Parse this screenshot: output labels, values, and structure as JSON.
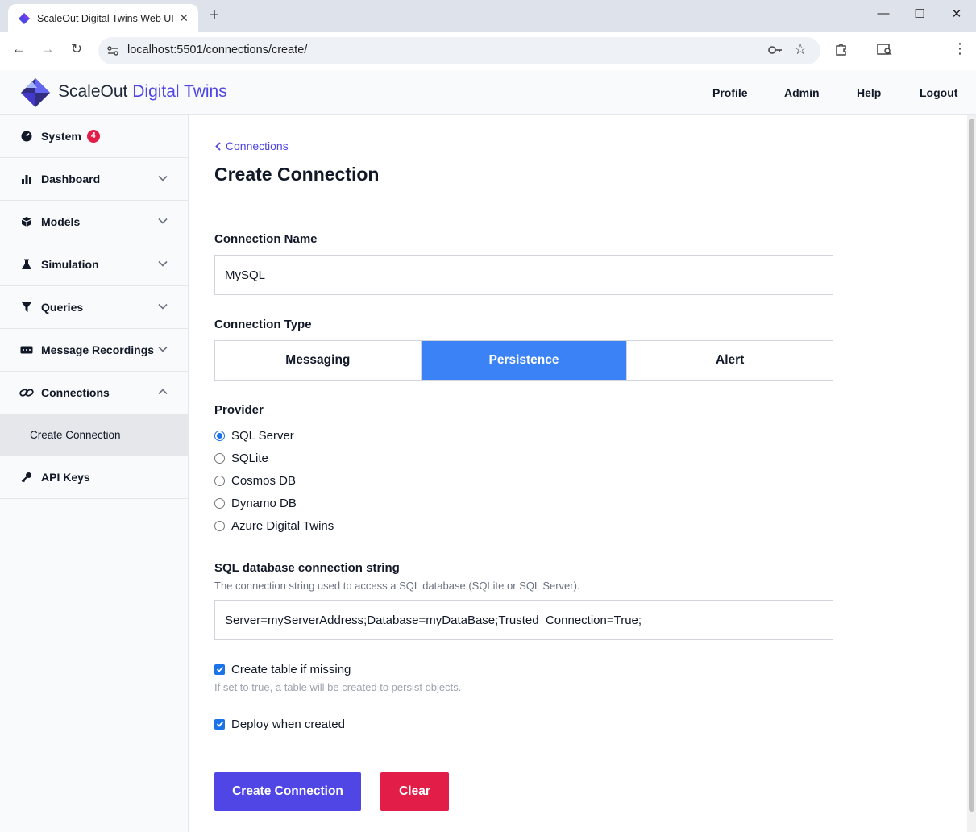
{
  "browser": {
    "tab_title": "ScaleOut Digital Twins Web UI",
    "tab_close": "✕",
    "new_tab": "+",
    "url": "localhost:5501/connections/create/",
    "window_controls": {
      "minimize": "—",
      "maximize": "☐",
      "close": "✕"
    }
  },
  "header": {
    "brand_main": "ScaleOut",
    "brand_accent": "Digital Twins",
    "nav": [
      "Profile",
      "Admin",
      "Help",
      "Logout"
    ]
  },
  "sidebar": {
    "items": [
      {
        "label": "System",
        "badge": "4",
        "icon": "dashboard-gauge-icon"
      },
      {
        "label": "Dashboard",
        "icon": "bar-chart-icon"
      },
      {
        "label": "Models",
        "icon": "cube-icon"
      },
      {
        "label": "Simulation",
        "icon": "flask-icon"
      },
      {
        "label": "Queries",
        "icon": "filter-icon"
      },
      {
        "label": "Message Recordings",
        "icon": "recording-icon"
      },
      {
        "label": "Connections",
        "icon": "link-icon",
        "expanded": true
      },
      {
        "label": "API Keys",
        "icon": "key-icon"
      }
    ],
    "sub_item": "Create Connection"
  },
  "main": {
    "back_link": "Connections",
    "title": "Create Connection",
    "connection_name_label": "Connection Name",
    "connection_name_value": "MySQL",
    "connection_type_label": "Connection Type",
    "connection_types": [
      "Messaging",
      "Persistence",
      "Alert"
    ],
    "selected_type": "Persistence",
    "provider_label": "Provider",
    "providers": [
      "SQL Server",
      "SQLite",
      "Cosmos DB",
      "Dynamo DB",
      "Azure Digital Twins"
    ],
    "selected_provider": "SQL Server",
    "conn_string_label": "SQL database connection string",
    "conn_string_help": "The connection string used to access a SQL database (SQLite or SQL Server).",
    "conn_string_value": "Server=myServerAddress;Database=myDataBase;Trusted_Connection=True;",
    "create_table_label": "Create table if missing",
    "create_table_checked": true,
    "create_table_help": "If set to true, a table will be created to persist objects.",
    "deploy_label": "Deploy when created",
    "deploy_checked": true,
    "create_button": "Create Connection",
    "clear_button": "Clear"
  },
  "colors": {
    "accent": "#4f46e5",
    "active_segment": "#3b82f6",
    "danger": "#e11d48"
  }
}
